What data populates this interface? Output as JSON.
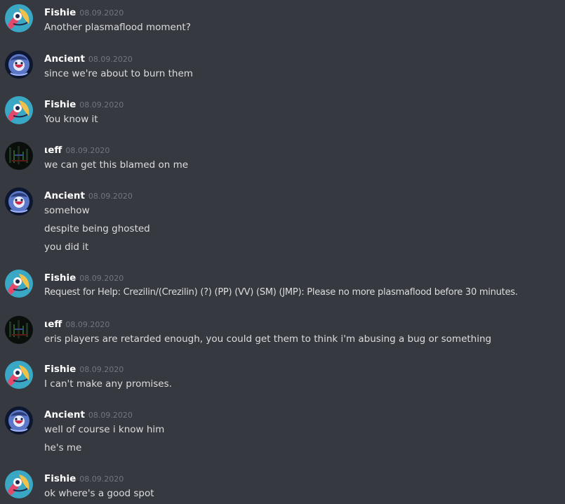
{
  "messages": [
    {
      "author": "Fishie",
      "timestamp": "08.09.2020",
      "avatar": "fishie-avatar",
      "lines": [
        "Another plasmaflood moment?"
      ]
    },
    {
      "author": "Ancient",
      "timestamp": "08.09.2020",
      "avatar": "ancient-avatar",
      "lines": [
        "since we're about to burn them"
      ]
    },
    {
      "author": "Fishie",
      "timestamp": "08.09.2020",
      "avatar": "fishie-avatar",
      "lines": [
        "You know it"
      ]
    },
    {
      "author": "ιeff",
      "timestamp": "08.09.2020",
      "avatar": "leff-avatar",
      "lines": [
        "we can get this blamed on me"
      ]
    },
    {
      "author": "Ancient",
      "timestamp": "08.09.2020",
      "avatar": "ancient-avatar",
      "lines": [
        "somehow",
        "despite being ghosted",
        "you did it"
      ]
    },
    {
      "author": "Fishie",
      "timestamp": "08.09.2020",
      "avatar": "fishie-avatar",
      "lines": [
        "Request for Help: Crezilin/(Crezilin) (?) (PP) (VV) (SM) (JMP): Please no more plasmaflood before 30 minutes."
      ]
    },
    {
      "author": "ιeff",
      "timestamp": "08.09.2020",
      "avatar": "leff-avatar",
      "lines": [
        "eris players are retarded enough, you could get them to think i'm abusing a bug or something"
      ]
    },
    {
      "author": "Fishie",
      "timestamp": "08.09.2020",
      "avatar": "fishie-avatar",
      "lines": [
        "I can't make any promises."
      ]
    },
    {
      "author": "Ancient",
      "timestamp": "08.09.2020",
      "avatar": "ancient-avatar",
      "lines": [
        "well of course i know him",
        "he's me"
      ]
    },
    {
      "author": "Fishie",
      "timestamp": "08.09.2020",
      "avatar": "fishie-avatar",
      "lines": [
        "ok where's a good spot"
      ]
    }
  ],
  "colors": {
    "background": "#36393f",
    "author": "#ffffff",
    "timestamp": "#72767d",
    "text": "#dcddde"
  }
}
